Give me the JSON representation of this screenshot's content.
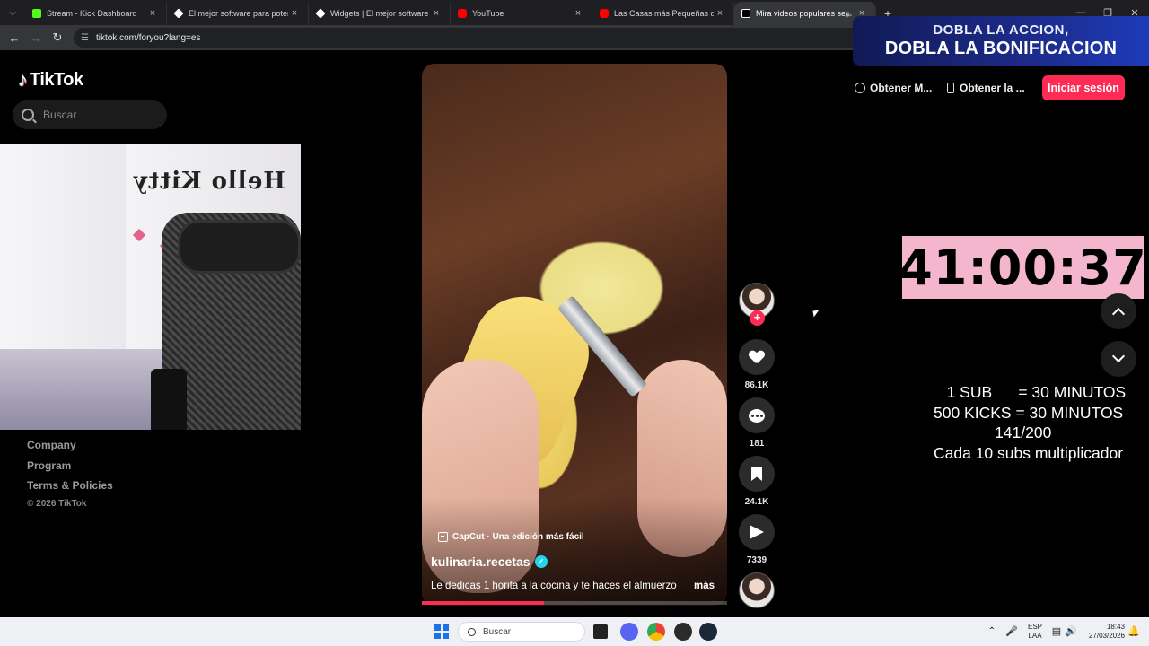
{
  "browser": {
    "tabs": [
      {
        "title": "Stream - Kick Dashboard",
        "fav_color": "#53fc18",
        "active": false
      },
      {
        "title": "El mejor software para potenciar",
        "fav_color": "#ffffff",
        "active": false
      },
      {
        "title": "Widgets | El mejor software para",
        "fav_color": "#ffffff",
        "active": false
      },
      {
        "title": "YouTube",
        "fav_color": "#ff0000",
        "active": false
      },
      {
        "title": "Las Casas más Pequeñas del Mu",
        "fav_color": "#ff0000",
        "active": false
      },
      {
        "title": "Mira videos populares selec",
        "fav_color": "#ffffff",
        "active": true
      }
    ],
    "new_tab": "+",
    "url": "tiktok.com/foryou?lang=es"
  },
  "tiktok": {
    "logo": "TikTok",
    "search_placeholder": "Buscar",
    "header": {
      "get_app": "Obtener M...",
      "get_tv": "Obtener la ...",
      "login": "Iniciar sesión"
    },
    "footer": {
      "company": "Company",
      "program": "Program",
      "terms": "Terms & Policies",
      "copyright": "© 2026 TikTok"
    },
    "video": {
      "capcut": "CapCut · Una edición más fácil",
      "author": "kulinaria.recetas",
      "caption": "Le dedicas 1 horita a la cocina y te haces el almuerzo",
      "more": "más",
      "progress": 0.4
    },
    "actions": {
      "likes": "86.1K",
      "comments": "181",
      "saves": "24.1K",
      "shares": "7339"
    }
  },
  "overlay": {
    "promo_line1": "DOBLA LA ACCION,",
    "promo_line2": "DOBLA LA BONIFICACION",
    "timer": "41:00:37",
    "rules": [
      "   1 SUB      = 30 MINUTOS",
      "500 KICKS = 30 MINUTOS",
      "              141/200",
      "Cada 10 subs multiplicador"
    ],
    "webcam_sticker": "Hello Kitty"
  },
  "taskbar": {
    "search": "Buscar",
    "lang_line1": "ESP",
    "lang_line2": "LAA",
    "time": "18:43",
    "date": "27/03/2026"
  }
}
